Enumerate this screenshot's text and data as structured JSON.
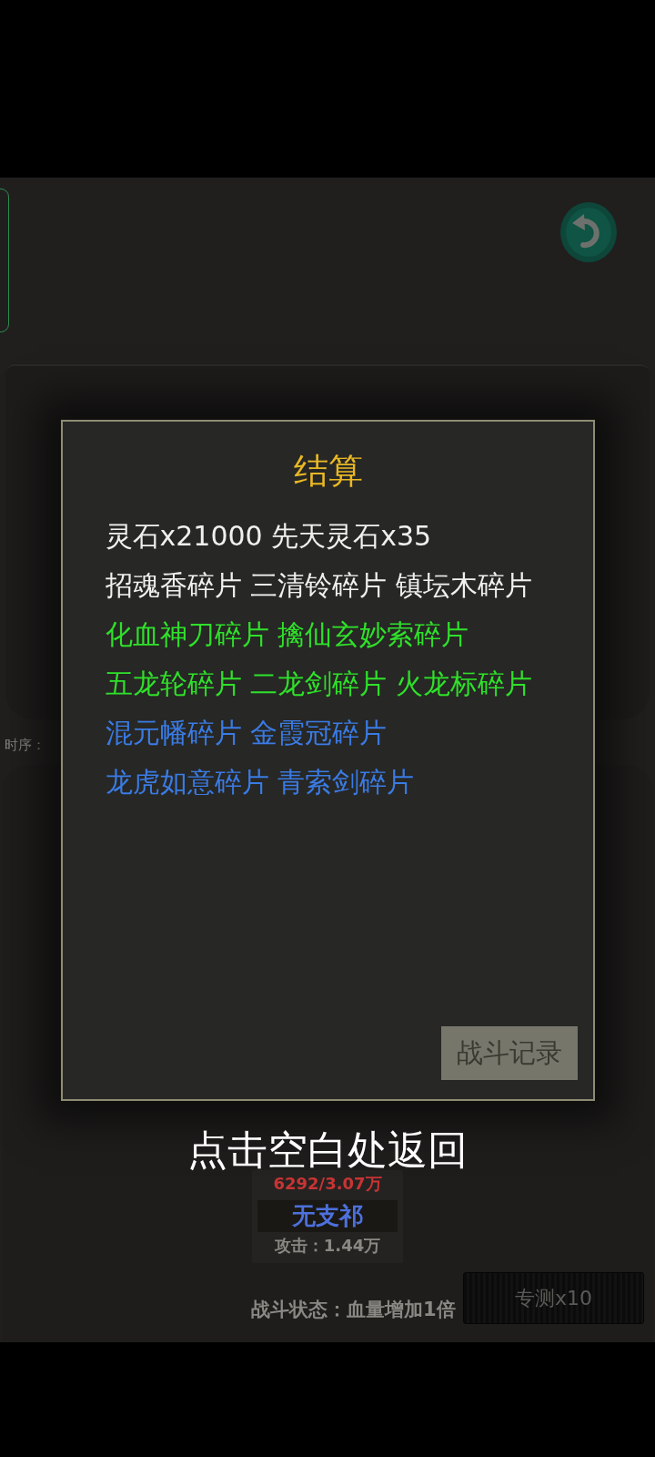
{
  "battlefield": {
    "timeline_label": "时序：",
    "enemy_card": {
      "hp": "6292/3.07万",
      "name": "无支祁",
      "attack": "攻击：1.44万"
    },
    "battle_status": "战斗状态：血量增加1倍",
    "test_button": "专测x10"
  },
  "result_dialog": {
    "title": "结算",
    "lines": [
      {
        "text": "灵石x21000 先天灵石x35",
        "color": "#f0f0ee"
      },
      {
        "text": "招魂香碎片 三清铃碎片 镇坛木碎片",
        "color": "#f0f0ee"
      },
      {
        "text": "化血神刀碎片 擒仙玄妙索碎片",
        "color": "#2fe02a"
      },
      {
        "text": "五龙轮碎片 二龙剑碎片 火龙标碎片",
        "color": "#2fe02a"
      },
      {
        "text": "混元幡碎片 金霞冠碎片",
        "color": "#3a7be4"
      },
      {
        "text": "龙虎如意碎片 青索剑碎片",
        "color": "#3a7be4"
      }
    ],
    "record_button": "战斗记录"
  },
  "dismiss_hint": "点击空白处返回"
}
